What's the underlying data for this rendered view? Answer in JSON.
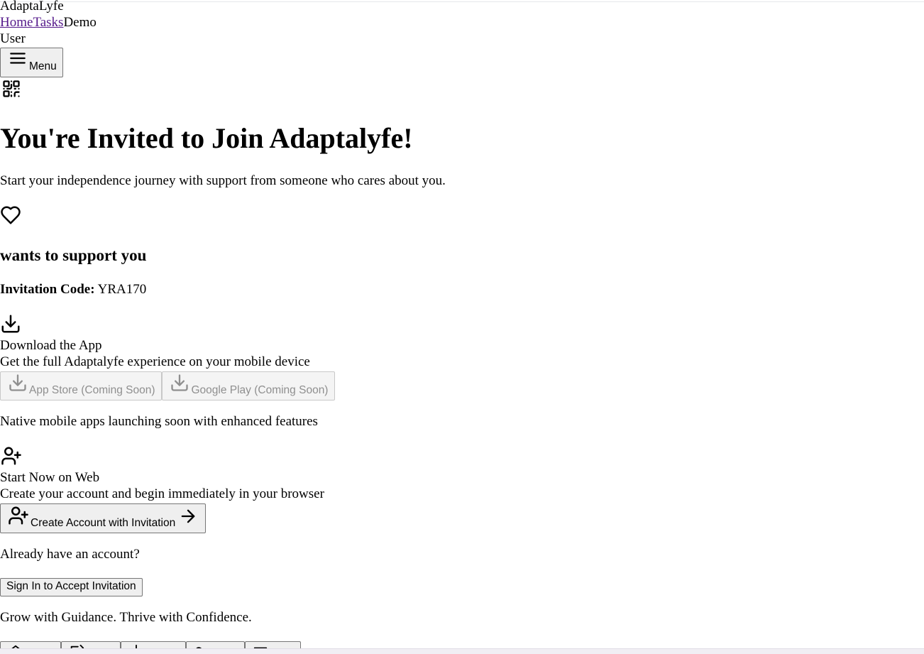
{
  "header": {
    "brand": "AdaptaLyfe",
    "nav": [
      {
        "label": "Home"
      },
      {
        "label": "Tasks"
      }
    ],
    "demo_label": "Demo",
    "user_label": "User",
    "menu_label": "Menu"
  },
  "invite": {
    "title": "You're Invited to Join Adaptalyfe!",
    "subtitle": "Start your independence journey with support from someone who cares about you.",
    "support_heading": "wants to support you",
    "code_label": "Invitation Code:",
    "code_value": "YRA170"
  },
  "download": {
    "title": "Download the App",
    "description": "Get the full Adaptalyfe experience on your mobile device",
    "app_store_label": "App Store (Coming Soon)",
    "google_play_label": "Google Play (Coming Soon)",
    "note": "Native mobile apps launching soon with enhanced features"
  },
  "web": {
    "title": "Start Now on Web",
    "description": "Create your account and begin immediately in your browser",
    "create_button_label": "Create Account with Invitation"
  },
  "signin": {
    "prompt": "Already have an account?",
    "button_label": "Sign In to Accept Invitation"
  },
  "tagline": "Grow with Guidance. Thrive with Confidence.",
  "bottom_nav_icons": [
    "home-icon",
    "edit-icon",
    "plus-icon",
    "heart-icon",
    "menu-icon"
  ],
  "colors": {
    "link": "#551a8b",
    "disabled_text": "#8f8f8f",
    "button_bg": "#efefef"
  }
}
